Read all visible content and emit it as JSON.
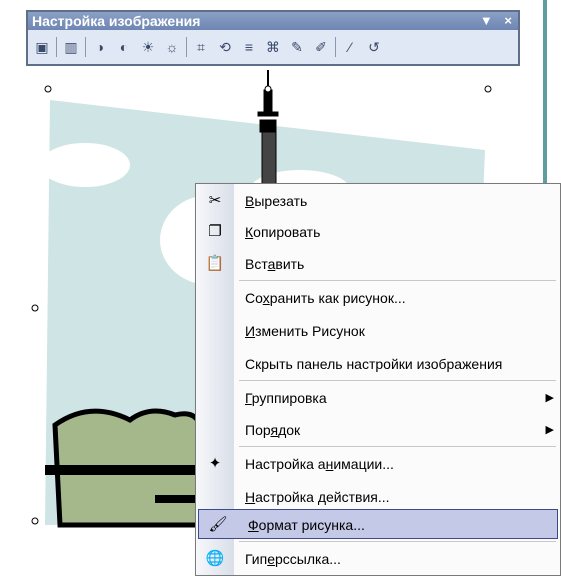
{
  "toolbar": {
    "title": "Настройка изображения",
    "controls": [
      "▼",
      "×"
    ],
    "icons": [
      "insert-picture-icon",
      "color-icon",
      "more-contrast-icon",
      "less-contrast-icon",
      "more-brightness-icon",
      "less-brightness-icon",
      "crop-icon",
      "rotate-icon",
      "line-style-icon",
      "compress-icon",
      "recolor-icon",
      "format-picture-icon",
      "set-transparent-color-icon",
      "reset-picture-icon"
    ]
  },
  "menu": {
    "items": [
      {
        "label": "Вырезать",
        "ul": "В",
        "rest": "ырезать",
        "icon": "scissors-icon",
        "glyph": "✂"
      },
      {
        "label": "Копировать",
        "ul": "К",
        "rest": "опировать",
        "icon": "copy-icon",
        "glyph": "❐"
      },
      {
        "label": "Вставить",
        "pre": "Вст",
        "ul": "а",
        "rest": "вить",
        "icon": "paste-icon",
        "glyph": "📋"
      },
      {
        "label": "Сохранить как рисунок...",
        "pre": "Со",
        "ul": "х",
        "rest": "ранить как рисунок..."
      },
      {
        "label": "Изменить Рисунок",
        "ul": "И",
        "rest": "зменить Рисунок"
      },
      {
        "label": "Скрыть панель настройки изображения"
      },
      {
        "label": "Группировка",
        "ul": "Г",
        "rest": "руппировка",
        "submenu": true
      },
      {
        "label": "Порядок",
        "pre": "Пор",
        "ul": "я",
        "rest": "док",
        "submenu": true
      },
      {
        "label": "Настройка анимации...",
        "pre": "Настройка а",
        "ul": "н",
        "rest": "имации...",
        "icon": "animation-icon",
        "glyph": "✦"
      },
      {
        "label": "Настройка действия...",
        "ul": "Н",
        "rest": "астройка действия..."
      },
      {
        "label": "Формат рисунка...",
        "ul": "Ф",
        "rest": "ормат рисунка...",
        "icon": "format-picture-icon",
        "glyph": "🖌",
        "highlighted": true
      },
      {
        "label": "Гиперссылка...",
        "pre": "Гип",
        "ul": "е",
        "rest": "рссылка...",
        "icon": "hyperlink-icon",
        "glyph": "🌐"
      }
    ],
    "submenu_arrow": "▶"
  }
}
